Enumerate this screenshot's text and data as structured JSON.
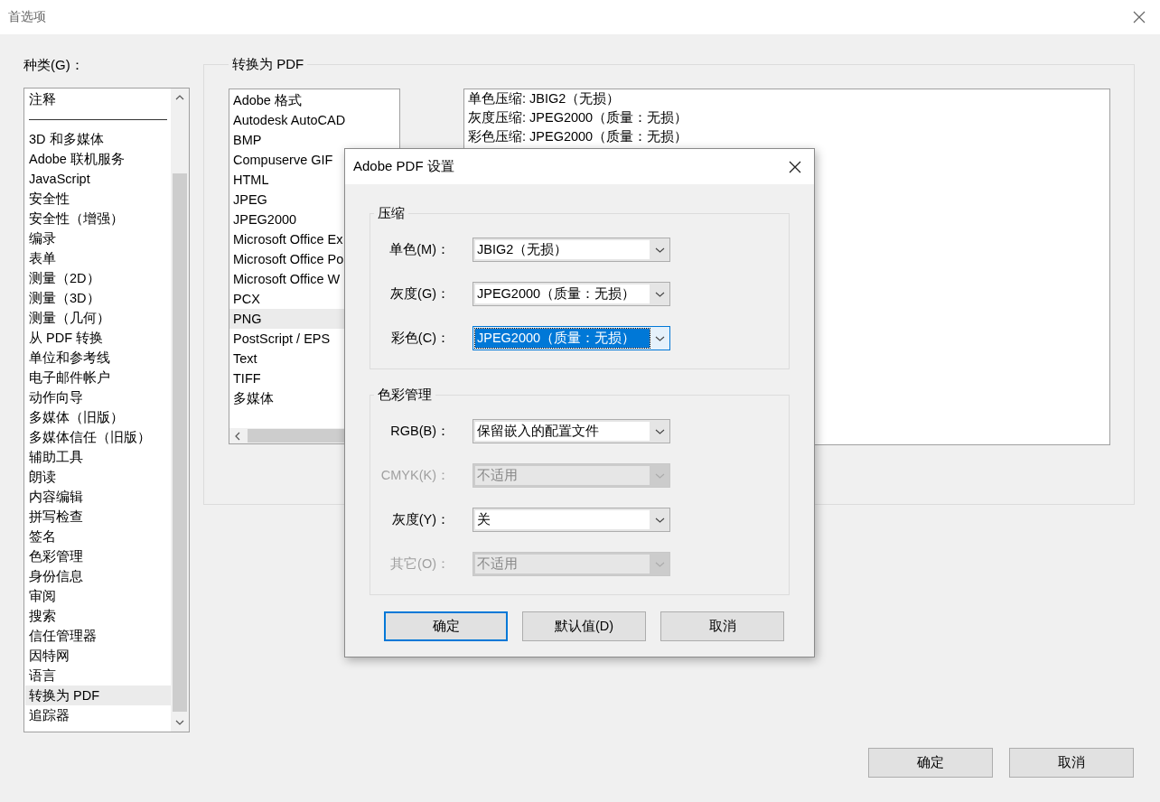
{
  "window": {
    "title": "首选项"
  },
  "categories": {
    "label": "种类(G)：",
    "items": [
      {
        "kind": "item",
        "label": "注释",
        "selected": false
      },
      {
        "kind": "separator"
      },
      {
        "kind": "item",
        "label": "3D 和多媒体",
        "selected": false
      },
      {
        "kind": "item",
        "label": "Adobe 联机服务",
        "selected": false
      },
      {
        "kind": "item",
        "label": "JavaScript",
        "selected": false
      },
      {
        "kind": "item",
        "label": "安全性",
        "selected": false
      },
      {
        "kind": "item",
        "label": "安全性（增强）",
        "selected": false
      },
      {
        "kind": "item",
        "label": "编录",
        "selected": false
      },
      {
        "kind": "item",
        "label": "表单",
        "selected": false
      },
      {
        "kind": "item",
        "label": "测量（2D）",
        "selected": false
      },
      {
        "kind": "item",
        "label": "测量（3D）",
        "selected": false
      },
      {
        "kind": "item",
        "label": "测量（几何）",
        "selected": false
      },
      {
        "kind": "item",
        "label": "从 PDF 转换",
        "selected": false
      },
      {
        "kind": "item",
        "label": "单位和参考线",
        "selected": false
      },
      {
        "kind": "item",
        "label": "电子邮件帐户",
        "selected": false
      },
      {
        "kind": "item",
        "label": "动作向导",
        "selected": false
      },
      {
        "kind": "item",
        "label": "多媒体（旧版）",
        "selected": false
      },
      {
        "kind": "item",
        "label": "多媒体信任（旧版）",
        "selected": false
      },
      {
        "kind": "item",
        "label": "辅助工具",
        "selected": false
      },
      {
        "kind": "item",
        "label": "朗读",
        "selected": false
      },
      {
        "kind": "item",
        "label": "内容编辑",
        "selected": false
      },
      {
        "kind": "item",
        "label": "拼写检查",
        "selected": false
      },
      {
        "kind": "item",
        "label": "签名",
        "selected": false
      },
      {
        "kind": "item",
        "label": "色彩管理",
        "selected": false
      },
      {
        "kind": "item",
        "label": "身份信息",
        "selected": false
      },
      {
        "kind": "item",
        "label": "审阅",
        "selected": false
      },
      {
        "kind": "item",
        "label": "搜索",
        "selected": false
      },
      {
        "kind": "item",
        "label": "信任管理器",
        "selected": false
      },
      {
        "kind": "item",
        "label": "因特网",
        "selected": false
      },
      {
        "kind": "item",
        "label": "语言",
        "selected": false
      },
      {
        "kind": "item",
        "label": "转换为 PDF",
        "selected": true
      },
      {
        "kind": "item",
        "label": "追踪器",
        "selected": false
      }
    ]
  },
  "panel": {
    "title": "转换为 PDF",
    "formats": [
      {
        "label": "Adobe 格式",
        "selected": false
      },
      {
        "label": "Autodesk AutoCAD",
        "selected": false
      },
      {
        "label": "BMP",
        "selected": false
      },
      {
        "label": "Compuserve GIF",
        "selected": false
      },
      {
        "label": "HTML",
        "selected": false
      },
      {
        "label": "JPEG",
        "selected": false
      },
      {
        "label": "JPEG2000",
        "selected": false
      },
      {
        "label": "Microsoft Office Ex",
        "selected": false
      },
      {
        "label": "Microsoft Office Po",
        "selected": false
      },
      {
        "label": "Microsoft Office W",
        "selected": false
      },
      {
        "label": "PCX",
        "selected": false
      },
      {
        "label": "PNG",
        "selected": true
      },
      {
        "label": "PostScript / EPS",
        "selected": false
      },
      {
        "label": "Text",
        "selected": false
      },
      {
        "label": "TIFF",
        "selected": false
      },
      {
        "label": "多媒体",
        "selected": false
      }
    ],
    "settings": [
      "单色压缩: JBIG2（无损）",
      "灰度压缩: JPEG2000（质量：无损）",
      "彩色压缩: JPEG2000（质量：无损）"
    ]
  },
  "buttons": [
    {
      "label": "确定"
    },
    {
      "label": "取消"
    }
  ],
  "dialog": {
    "title": "Adobe PDF 设置",
    "groups": [
      {
        "title": "压缩",
        "fields": [
          {
            "label": "单色(M)：",
            "value": "JBIG2（无损）",
            "disabled": false,
            "focused": false
          },
          {
            "label": "灰度(G)：",
            "value": "JPEG2000（质量：无损）",
            "disabled": false,
            "focused": false
          },
          {
            "label": "彩色(C)：",
            "value": "JPEG2000（质量：无损）",
            "disabled": false,
            "focused": true
          }
        ]
      },
      {
        "title": "色彩管理",
        "fields": [
          {
            "label": "RGB(B)：",
            "value": "保留嵌入的配置文件",
            "disabled": false,
            "focused": false
          },
          {
            "label": "CMYK(K)：",
            "value": "不适用",
            "disabled": true,
            "focused": false
          },
          {
            "label": "灰度(Y)：",
            "value": "关",
            "disabled": false,
            "focused": false
          },
          {
            "label": "其它(O)：",
            "value": "不适用",
            "disabled": true,
            "focused": false
          }
        ]
      }
    ],
    "buttons": [
      {
        "label": "确定",
        "default": true
      },
      {
        "label": "默认值(D)",
        "default": false
      },
      {
        "label": "取消",
        "default": false
      }
    ]
  }
}
